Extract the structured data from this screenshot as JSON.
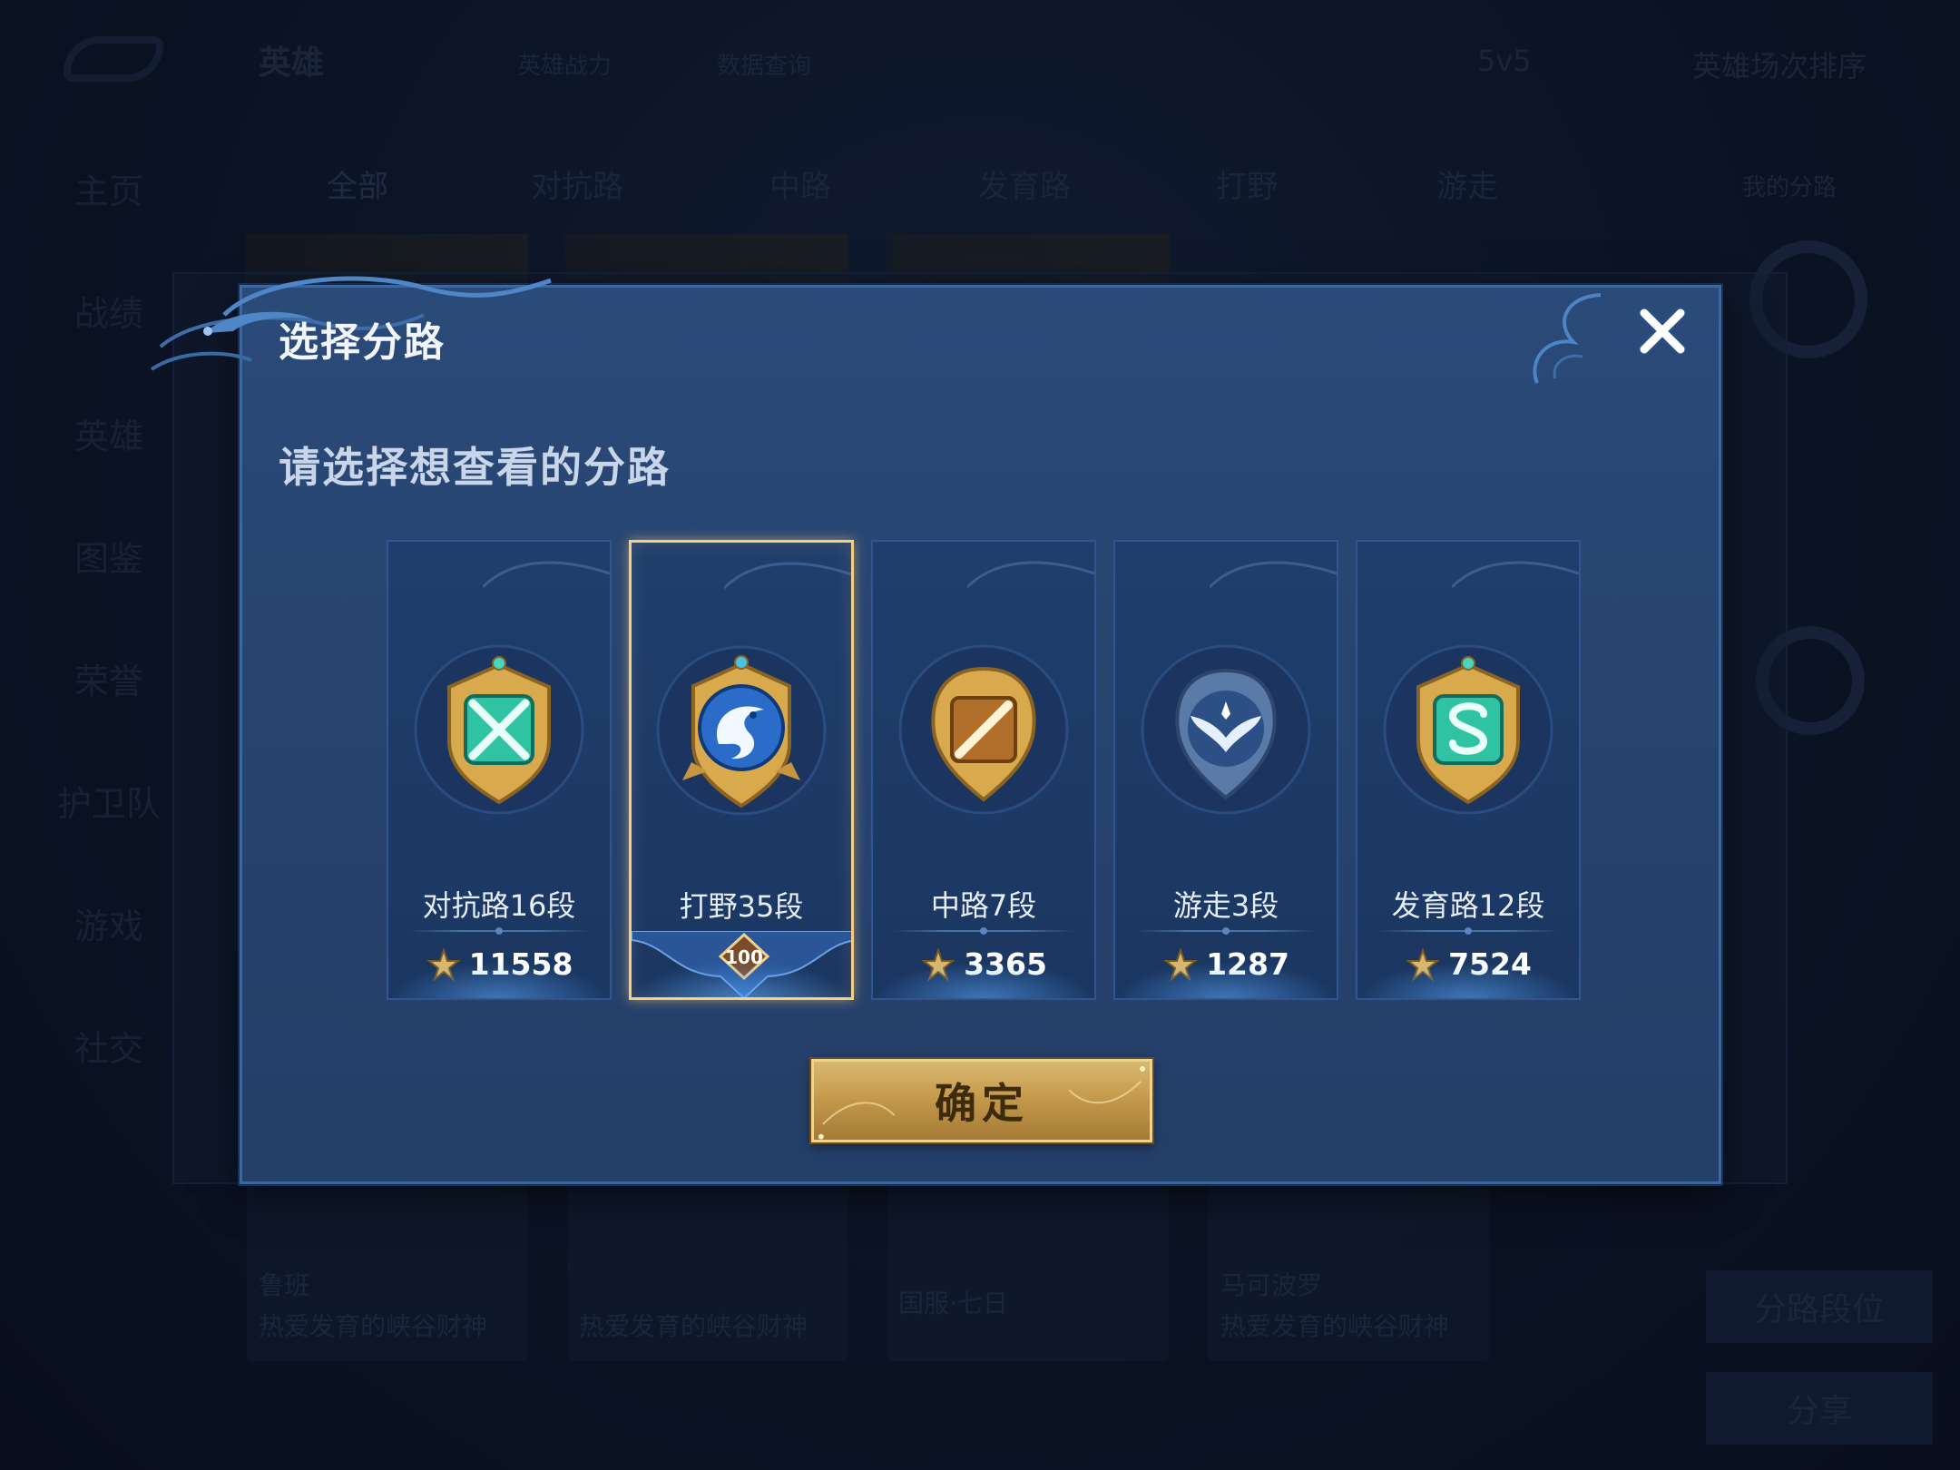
{
  "background": {
    "top_nav": {
      "title": "英雄",
      "items": [
        "英雄战力",
        "数据查询"
      ],
      "mode": "5v5",
      "sort": "英雄场次排序"
    },
    "sidebar": [
      "主页",
      "战绩",
      "英雄",
      "图鉴",
      "荣誉",
      "护卫队",
      "游戏",
      "社交"
    ],
    "tabs": [
      "全部",
      "对抗路",
      "中路",
      "发育路",
      "打野",
      "游走"
    ],
    "tab_right": "我的分路",
    "hero_cards": [
      {
        "name": "鲁班",
        "subtitle": "热爱发育的峡谷财神"
      },
      {
        "name": "",
        "subtitle": "热爱发育的峡谷财神"
      },
      {
        "name": "",
        "subtitle": "国服·七日"
      },
      {
        "name": "马可波罗",
        "subtitle": "热爱发育的峡谷财神"
      }
    ],
    "right_panel": {
      "lane_rank_button": "分路段位",
      "share_button": "分享"
    }
  },
  "modal": {
    "title": "选择分路",
    "subtitle": "请选择想查看的分路",
    "lanes": [
      {
        "name": "对抗路16段",
        "score": "11558",
        "badge": "sword-badge",
        "selected": false
      },
      {
        "name": "打野35段",
        "score": "",
        "badge": "dragon-badge",
        "selected": true,
        "ribbon_level": "100"
      },
      {
        "name": "中路7段",
        "score": "3365",
        "badge": "mid-badge",
        "selected": false
      },
      {
        "name": "游走3段",
        "score": "1287",
        "badge": "wings-badge",
        "selected": false
      },
      {
        "name": "发育路12段",
        "score": "7524",
        "badge": "farm-badge",
        "selected": false
      }
    ],
    "confirm_label": "确定"
  },
  "colors": {
    "modal_bg": "#27446f",
    "selected_border": "#f6cf87",
    "confirm_gold": "#c69a4c"
  }
}
